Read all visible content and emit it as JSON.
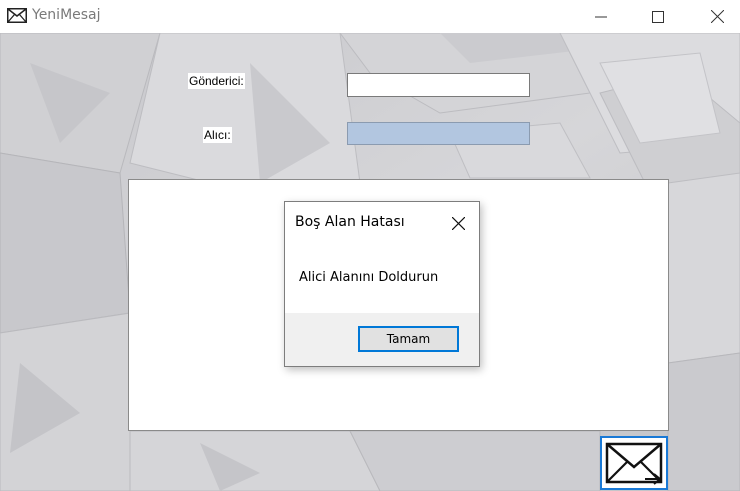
{
  "window": {
    "title": "YeniMesaj",
    "icon": "envelope-icon",
    "controls": [
      "minimize-icon",
      "maximize-icon",
      "close-icon"
    ]
  },
  "form": {
    "sender_label": "Gönderici:",
    "sender_value": "",
    "recipient_label": "Alıcı:",
    "recipient_value": "",
    "message_value": "",
    "send_icon": "send-mail-icon"
  },
  "dialog": {
    "title": "Boş Alan Hatası",
    "message": "Alici Alanını Doldurun",
    "ok_label": "Tamam"
  },
  "colors": {
    "focused_field": "#b2c6e0",
    "accent_border": "#0078d7"
  }
}
